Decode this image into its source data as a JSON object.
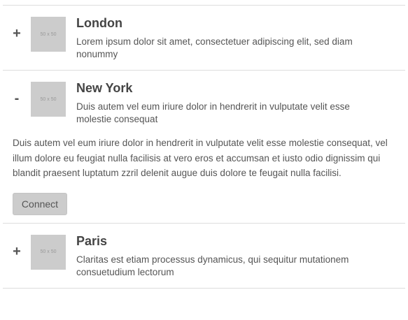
{
  "items": [
    {
      "toggle": "+",
      "thumb_label": "50 x 50",
      "title": "London",
      "summary": "Lorem ipsum dolor sit amet, consectetuer adipiscing elit, sed diam nonummy"
    },
    {
      "toggle": "-",
      "thumb_label": "50 x 50",
      "title": "New York",
      "summary": "Duis autem vel eum iriure dolor in hendrerit in vulputate velit esse molestie consequat",
      "body": "Duis autem vel eum iriure dolor in hendrerit in vulputate velit esse molestie consequat, vel illum dolore eu feugiat nulla facilisis at vero eros et accumsan et iusto odio dignissim qui blandit praesent luptatum zzril delenit augue duis dolore te feugait nulla facilisi.",
      "button_label": "Connect"
    },
    {
      "toggle": "+",
      "thumb_label": "50 x 50",
      "title": "Paris",
      "summary": "Claritas est etiam processus dynamicus, qui sequitur mutationem consuetudium lectorum"
    }
  ]
}
